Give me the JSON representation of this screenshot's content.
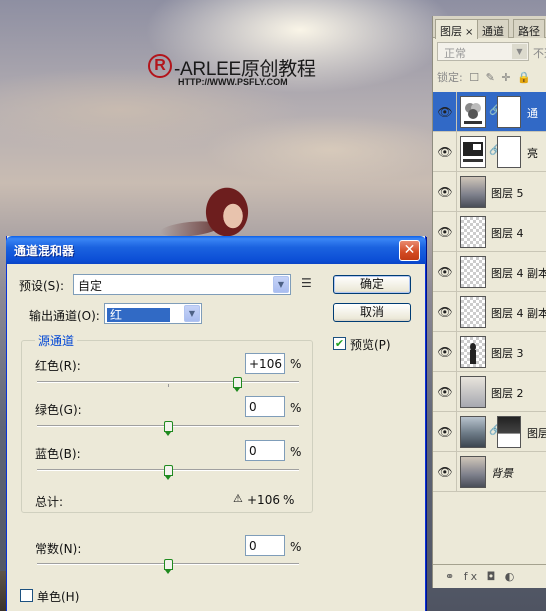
{
  "watermark": {
    "logo_letter": "R",
    "title": "-ARLEE原创教程",
    "url": "HTTP://WWW.PSFLY.COM"
  },
  "layers_panel": {
    "tabs": [
      {
        "label": "图层",
        "close": "×"
      },
      {
        "label": "通道"
      },
      {
        "label": "路径"
      }
    ],
    "blend_mode": "正常",
    "opacity_label": "不透",
    "lock_label": "锁定:",
    "lock_icons": [
      "☐",
      "✎",
      "✛",
      "🔒"
    ],
    "layers": [
      {
        "name": "通",
        "type": "adjustment-mixer",
        "mask": true,
        "selected": true
      },
      {
        "name": "亮",
        "type": "adjustment-levels",
        "mask": true,
        "selected": false
      },
      {
        "name": "图层 5",
        "type": "photo",
        "mask": false,
        "selected": false
      },
      {
        "name": "图层 4",
        "type": "transparent",
        "mask": false,
        "selected": false
      },
      {
        "name": "图层 4 副本",
        "type": "transparent",
        "mask": false,
        "selected": false
      },
      {
        "name": "图层 4 副本",
        "type": "transparent",
        "mask": false,
        "selected": false
      },
      {
        "name": "图层 3",
        "type": "figure",
        "mask": false,
        "selected": false
      },
      {
        "name": "图层 2",
        "type": "sky",
        "mask": false,
        "selected": false
      },
      {
        "name": "图层",
        "type": "land",
        "mask": true,
        "selected": false
      },
      {
        "name": "背景",
        "type": "background",
        "mask": false,
        "selected": false
      }
    ],
    "bottom_icons": "⚭ fx ◘ ◐"
  },
  "dialog": {
    "title": "通道混和器",
    "close": "✕",
    "preset_label": "预设(S):",
    "preset_value": "自定",
    "output_label": "输出通道(O):",
    "output_value": "红",
    "ok_label": "确定",
    "cancel_label": "取消",
    "preview_label": "预览(P)",
    "preview_checked": true,
    "source_title": "源通道",
    "channels": [
      {
        "label": "红色(R):",
        "value": "+106",
        "unit": "%",
        "level": 106
      },
      {
        "label": "绿色(G):",
        "value": "0",
        "unit": "%",
        "level": 0
      },
      {
        "label": "蓝色(B):",
        "value": "0",
        "unit": "%",
        "level": 0
      }
    ],
    "total_label": "总计:",
    "total_value": "+106",
    "total_unit": "%",
    "constant_label": "常数(N):",
    "constant_value": "0",
    "constant_unit": "%",
    "constant_level": 0,
    "monochrome_label": "单色(H)",
    "monochrome_checked": false
  }
}
